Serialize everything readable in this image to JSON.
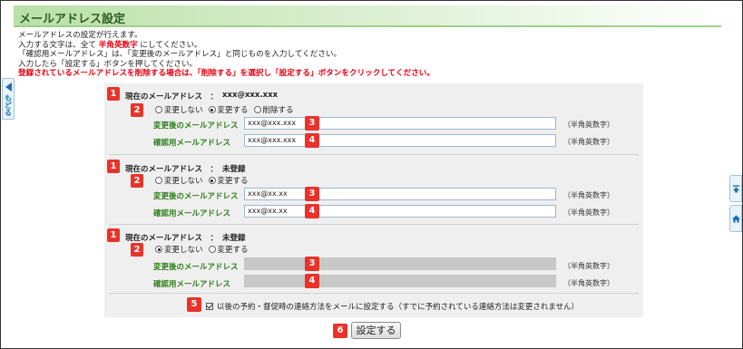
{
  "page": {
    "title": "メールアドレス設定",
    "intro_line1": "メールアドレスの設定が行えます。",
    "intro_line2_pre": "入力する文字は、全て",
    "intro_line2_em": "半角英数字",
    "intro_line2_post": "にしてください。",
    "intro_line3": "「確認用メールアドレス」は、「変更後のメールアドレス」と同じものを入力してください。",
    "intro_line4": "入力したら「設定する」ボタンを押してください。",
    "intro_warning": "登録されているメールアドレスを削除する場合は、「削除する」を選択し「設定する」ボタンをクリックしてください。"
  },
  "nav": {
    "back_label": "もどる",
    "side_top_icon": "page-top-icon",
    "side_home_icon": "home-icon"
  },
  "badges": {
    "current": "1",
    "mode": "2",
    "new_address": "3",
    "confirm_address": "4",
    "notify": "5",
    "submit": "6"
  },
  "labels": {
    "current": "現在のメールアドレス　：",
    "new_address": "変更後のメールアドレス",
    "confirm_address": "確認用メールアドレス",
    "note": "（半角英数字）",
    "opt_keep": "変更しない",
    "opt_change": "変更する",
    "opt_delete": "削除する"
  },
  "sections": [
    {
      "current_value": "xxx@xxx.xxx",
      "options": [
        "変更しない",
        "変更する",
        "削除する"
      ],
      "selected": "変更する",
      "new_value": "xxx@xxx.xxx",
      "confirm_value": "xxx@xxx.xxx",
      "disabled": false
    },
    {
      "current_value": "未登録",
      "options": [
        "変更しない",
        "変更する"
      ],
      "selected": "変更する",
      "new_value": "xxx@xx.xx",
      "confirm_value": "xxx@xx.xx",
      "disabled": false
    },
    {
      "current_value": "未登録",
      "options": [
        "変更しない",
        "変更する"
      ],
      "selected": "変更しない",
      "new_value": "",
      "confirm_value": "",
      "disabled": true
    }
  ],
  "notify": {
    "checked": true,
    "label": "以後の予約・督促時の連絡方法をメールに設定する（すでに予約されている連絡方法は変更されません）"
  },
  "submit_label": "設定する",
  "colors": {
    "badge": "#e9332a",
    "field_label": "#2e7d1a",
    "warning": "#e60012",
    "panel": "#efefef",
    "title_bar": "#b9e0a8"
  }
}
